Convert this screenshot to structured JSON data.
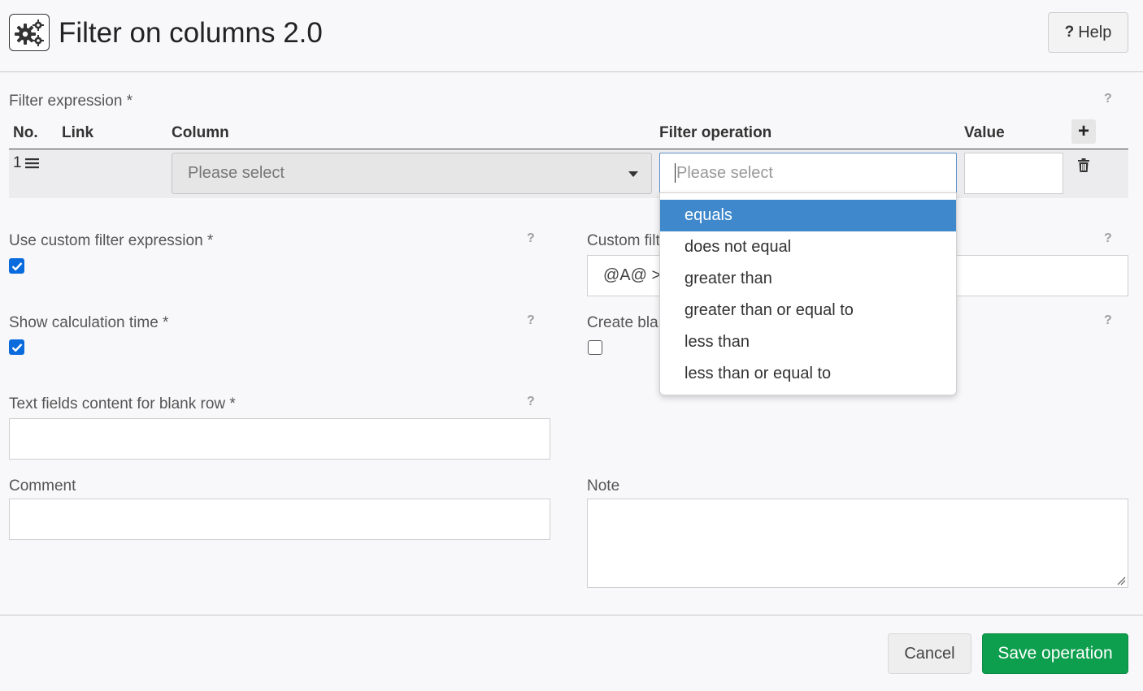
{
  "header": {
    "app_icon": "gears-icon",
    "title": "Filter on columns 2.0",
    "help_label": "Help",
    "help_icon_glyph": "?"
  },
  "filter_expression": {
    "label": "Filter expression *",
    "help_glyph": "?",
    "columns": {
      "no": "No.",
      "link": "Link",
      "column": "Column",
      "filter_operation": "Filter operation",
      "value": "Value"
    },
    "add_glyph": "+",
    "rows": [
      {
        "number": "1",
        "column_value": "Please select",
        "filter_operation_placeholder": "Please select",
        "value": ""
      }
    ],
    "dropdown_options": [
      "equals",
      "does not equal",
      "greater than",
      "greater than or equal to",
      "less than",
      "less than or equal to"
    ],
    "dropdown_active_index": 0
  },
  "form": {
    "use_custom_filter": {
      "label": "Use custom filter expression *",
      "checked": true
    },
    "custom_filter": {
      "label_visible": "Custom filt",
      "value_visible": "@A@ >"
    },
    "show_calc_time": {
      "label": "Show calculation time *",
      "checked": true
    },
    "create_blank": {
      "label_visible": "Create bla",
      "checked": false
    },
    "text_fields_blank_row": {
      "label": "Text fields content for blank row *",
      "value": ""
    },
    "comment": {
      "label": "Comment",
      "value": ""
    },
    "note": {
      "label": "Note",
      "value": ""
    },
    "help_glyph": "?"
  },
  "footer": {
    "cancel_label": "Cancel",
    "save_label": "Save operation"
  },
  "colors": {
    "accent_blue": "#3f88cc",
    "checkbox_blue": "#0a6bdc",
    "save_green": "#0e9f4e"
  }
}
